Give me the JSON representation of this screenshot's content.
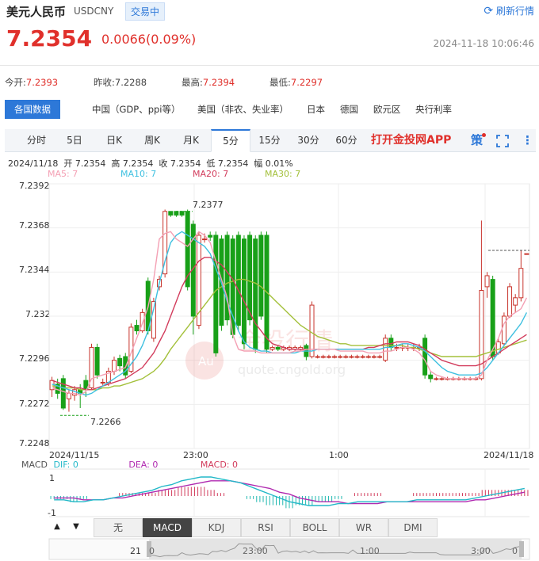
{
  "header": {
    "title": "美元人民币",
    "code": "USDCNY",
    "status": "交易中",
    "refresh": "刷新行情",
    "price": "7.2354",
    "change": "0.0066(0.09%)",
    "time": "2024-11-18 10:06:46"
  },
  "quote": {
    "open_label": "今开:",
    "open": "7.2393",
    "prev_label": "昨收:",
    "prev": "7.2288",
    "high_label": "最高:",
    "high": "7.2394",
    "low_label": "最低:",
    "low": "7.2297"
  },
  "data_tabs": [
    {
      "label": "各国数据"
    },
    {
      "label": "中国（GDP、ppi等）"
    },
    {
      "label": "美国（非农、失业率）"
    },
    {
      "label": "日本"
    },
    {
      "label": "德国"
    },
    {
      "label": "欧元区"
    },
    {
      "label": "央行利率"
    }
  ],
  "period_tabs": [
    "分时",
    "5日",
    "日K",
    "周K",
    "月K",
    "5分",
    "15分",
    "30分",
    "60分"
  ],
  "promo": "打开金投网APP",
  "icons": {
    "strategy": "策",
    "fullscreen": "fullscreen-icon",
    "more": "more-icon"
  },
  "info_line": "2024/11/18  开 7.2354  高 7.2354  收 7.2354  低 7.2354  幅 0.01%",
  "ma": {
    "ma5": "MA5: 7",
    "ma10": "MA10: 7",
    "ma20": "MA20: 7",
    "ma30": "MA30: 7",
    "colors": {
      "ma5": "#f4a0b4",
      "ma10": "#3ec0e0",
      "ma20": "#d23c5c",
      "ma30": "#a3c03a"
    }
  },
  "watermark": {
    "text": "金投行情",
    "url": "quote.cngold.org",
    "logo": "Au"
  },
  "chart_data": {
    "type": "candlestick",
    "y_ticks": [
      "7.2392",
      "7.2368",
      "7.2344",
      "7.232",
      "7.2296",
      "7.2272",
      "7.2248"
    ],
    "ylim": [
      7.2248,
      7.2392
    ],
    "x_labels": [
      "2024/11/15",
      "23:00",
      "1:00",
      "2024/11/18"
    ],
    "annotations": {
      "high": "7.2377",
      "low": "7.2266"
    },
    "candles": [
      {
        "o": 7.228,
        "c": 7.2285,
        "h": 7.2287,
        "l": 7.2276
      },
      {
        "o": 7.2283,
        "c": 7.2278,
        "h": 7.2286,
        "l": 7.2275
      },
      {
        "o": 7.2286,
        "c": 7.227,
        "h": 7.2288,
        "l": 7.2269
      },
      {
        "o": 7.2275,
        "c": 7.2278,
        "h": 7.228,
        "l": 7.2268
      },
      {
        "o": 7.2277,
        "c": 7.228,
        "h": 7.2282,
        "l": 7.2274
      },
      {
        "o": 7.228,
        "c": 7.2278,
        "h": 7.2283,
        "l": 7.227
      },
      {
        "o": 7.2285,
        "c": 7.228,
        "h": 7.2288,
        "l": 7.2276
      },
      {
        "o": 7.2281,
        "c": 7.2303,
        "h": 7.2305,
        "l": 7.228
      },
      {
        "o": 7.2303,
        "c": 7.2288,
        "h": 7.2305,
        "l": 7.2286
      },
      {
        "o": 7.2284,
        "c": 7.2284,
        "h": 7.2286,
        "l": 7.2282
      },
      {
        "o": 7.2284,
        "c": 7.229,
        "h": 7.2292,
        "l": 7.2282
      },
      {
        "o": 7.229,
        "c": 7.2296,
        "h": 7.2298,
        "l": 7.2288
      },
      {
        "o": 7.2297,
        "c": 7.2293,
        "h": 7.2299,
        "l": 7.229
      },
      {
        "o": 7.2298,
        "c": 7.2288,
        "h": 7.23,
        "l": 7.2286
      },
      {
        "o": 7.229,
        "c": 7.2314,
        "h": 7.2316,
        "l": 7.2289
      },
      {
        "o": 7.2315,
        "c": 7.2312,
        "h": 7.2318,
        "l": 7.231
      },
      {
        "o": 7.2312,
        "c": 7.2322,
        "h": 7.2324,
        "l": 7.2311
      },
      {
        "o": 7.2339,
        "c": 7.2312,
        "h": 7.2341,
        "l": 7.231
      },
      {
        "o": 7.2308,
        "c": 7.2328,
        "h": 7.233,
        "l": 7.2306
      },
      {
        "o": 7.2336,
        "c": 7.234,
        "h": 7.2342,
        "l": 7.2334
      },
      {
        "o": 7.2343,
        "c": 7.2377,
        "h": 7.2378,
        "l": 7.2341
      },
      {
        "o": 7.2377,
        "c": 7.2375,
        "h": 7.2377,
        "l": 7.2374
      },
      {
        "o": 7.2377,
        "c": 7.2375,
        "h": 7.2377,
        "l": 7.2374
      },
      {
        "o": 7.2377,
        "c": 7.2375,
        "h": 7.2377,
        "l": 7.2374
      },
      {
        "o": 7.2377,
        "c": 7.2336,
        "h": 7.2378,
        "l": 7.2334
      },
      {
        "o": 7.237,
        "c": 7.232,
        "h": 7.2372,
        "l": 7.231
      },
      {
        "o": 7.2315,
        "c": 7.2364,
        "h": 7.2366,
        "l": 7.2313
      },
      {
        "o": 7.2362,
        "c": 7.2362,
        "h": 7.2365,
        "l": 7.236
      },
      {
        "o": 7.2364,
        "c": 7.2363,
        "h": 7.2366,
        "l": 7.2361
      },
      {
        "o": 7.2364,
        "c": 7.23,
        "h": 7.2366,
        "l": 7.2298
      },
      {
        "o": 7.2362,
        "c": 7.2315,
        "h": 7.2364,
        "l": 7.2312
      },
      {
        "o": 7.2364,
        "c": 7.2318,
        "h": 7.2366,
        "l": 7.2315
      },
      {
        "o": 7.2362,
        "c": 7.231,
        "h": 7.2364,
        "l": 7.2308
      },
      {
        "o": 7.2364,
        "c": 7.2315,
        "h": 7.2366,
        "l": 7.2312
      },
      {
        "o": 7.2362,
        "c": 7.2305,
        "h": 7.2364,
        "l": 7.2302
      },
      {
        "o": 7.2364,
        "c": 7.2318,
        "h": 7.2366,
        "l": 7.2315
      },
      {
        "o": 7.2362,
        "c": 7.2302,
        "h": 7.2364,
        "l": 7.23
      },
      {
        "o": 7.2364,
        "c": 7.232,
        "h": 7.2366,
        "l": 7.2318
      },
      {
        "o": 7.2364,
        "c": 7.2302,
        "h": 7.2366,
        "l": 7.23
      },
      {
        "o": 7.2302,
        "c": 7.2303,
        "h": 7.2304,
        "l": 7.2301
      },
      {
        "o": 7.2303,
        "c": 7.2302,
        "h": 7.2304,
        "l": 7.2301
      },
      {
        "o": 7.2302,
        "c": 7.2303,
        "h": 7.2304,
        "l": 7.2301
      },
      {
        "o": 7.2302,
        "c": 7.2303,
        "h": 7.2304,
        "l": 7.2301
      },
      {
        "o": 7.2302,
        "c": 7.2303,
        "h": 7.2304,
        "l": 7.2301
      },
      {
        "o": 7.2302,
        "c": 7.2303,
        "h": 7.2304,
        "l": 7.2301
      },
      {
        "o": 7.2304,
        "c": 7.2298,
        "h": 7.2305,
        "l": 7.2296
      },
      {
        "o": 7.2298,
        "c": 7.2326,
        "h": 7.2328,
        "l": 7.2297
      },
      {
        "o": 7.2298,
        "c": 7.2298,
        "h": 7.2299,
        "l": 7.2297
      },
      {
        "o": 7.2298,
        "c": 7.2298,
        "h": 7.2299,
        "l": 7.2297
      },
      {
        "o": 7.2298,
        "c": 7.2298,
        "h": 7.2299,
        "l": 7.2297
      },
      {
        "o": 7.2298,
        "c": 7.2298,
        "h": 7.2299,
        "l": 7.2297
      },
      {
        "o": 7.2298,
        "c": 7.2298,
        "h": 7.2299,
        "l": 7.2297
      },
      {
        "o": 7.2298,
        "c": 7.2298,
        "h": 7.2299,
        "l": 7.2297
      },
      {
        "o": 7.2298,
        "c": 7.2298,
        "h": 7.2299,
        "l": 7.2297
      },
      {
        "o": 7.2298,
        "c": 7.2298,
        "h": 7.2299,
        "l": 7.2297
      },
      {
        "o": 7.2298,
        "c": 7.2298,
        "h": 7.2299,
        "l": 7.2297
      },
      {
        "o": 7.2298,
        "c": 7.2298,
        "h": 7.2299,
        "l": 7.2297
      },
      {
        "o": 7.2298,
        "c": 7.2298,
        "h": 7.2299,
        "l": 7.2297
      },
      {
        "o": 7.2298,
        "c": 7.2298,
        "h": 7.2299,
        "l": 7.2297
      },
      {
        "o": 7.2296,
        "c": 7.2308,
        "h": 7.231,
        "l": 7.2295
      },
      {
        "o": 7.2308,
        "c": 7.2303,
        "h": 7.231,
        "l": 7.2301
      },
      {
        "o": 7.2303,
        "c": 7.2303,
        "h": 7.2305,
        "l": 7.2301
      },
      {
        "o": 7.2303,
        "c": 7.2303,
        "h": 7.2305,
        "l": 7.2301
      },
      {
        "o": 7.2303,
        "c": 7.2303,
        "h": 7.2305,
        "l": 7.2301
      },
      {
        "o": 7.2303,
        "c": 7.2303,
        "h": 7.2305,
        "l": 7.2301
      },
      {
        "o": 7.2303,
        "c": 7.2303,
        "h": 7.2305,
        "l": 7.2301
      },
      {
        "o": 7.2308,
        "c": 7.2288,
        "h": 7.231,
        "l": 7.2286
      },
      {
        "o": 7.2288,
        "c": 7.2286,
        "h": 7.229,
        "l": 7.2284
      },
      {
        "o": 7.2286,
        "c": 7.2286,
        "h": 7.2287,
        "l": 7.2285
      },
      {
        "o": 7.2286,
        "c": 7.2286,
        "h": 7.2287,
        "l": 7.2285
      },
      {
        "o": 7.2286,
        "c": 7.2286,
        "h": 7.2287,
        "l": 7.2285
      },
      {
        "o": 7.2286,
        "c": 7.2286,
        "h": 7.2287,
        "l": 7.2285
      },
      {
        "o": 7.2286,
        "c": 7.2286,
        "h": 7.2287,
        "l": 7.2285
      },
      {
        "o": 7.2286,
        "c": 7.2286,
        "h": 7.2287,
        "l": 7.2285
      },
      {
        "o": 7.2286,
        "c": 7.2286,
        "h": 7.2287,
        "l": 7.2285
      },
      {
        "o": 7.2286,
        "c": 7.2286,
        "h": 7.2287,
        "l": 7.2285
      },
      {
        "o": 7.2286,
        "c": 7.2334,
        "h": 7.2372,
        "l": 7.2285
      },
      {
        "o": 7.2336,
        "c": 7.2342,
        "h": 7.2344,
        "l": 7.233
      },
      {
        "o": 7.234,
        "c": 7.2298,
        "h": 7.2342,
        "l": 7.2296
      },
      {
        "o": 7.23,
        "c": 7.2306,
        "h": 7.2308,
        "l": 7.2299
      },
      {
        "o": 7.2305,
        "c": 7.232,
        "h": 7.2322,
        "l": 7.2304
      },
      {
        "o": 7.232,
        "c": 7.2336,
        "h": 7.2338,
        "l": 7.2319
      },
      {
        "o": 7.2326,
        "c": 7.233,
        "h": 7.2332,
        "l": 7.2322
      },
      {
        "o": 7.233,
        "c": 7.2346,
        "h": 7.2356,
        "l": 7.2328
      },
      {
        "o": 7.2354,
        "c": 7.2354,
        "h": 7.2354,
        "l": 7.2354
      }
    ],
    "ma5": [
      7.2281,
      7.228,
      7.2279,
      7.2278,
      7.2278,
      7.2277,
      7.2279,
      7.2286,
      7.2287,
      7.2288,
      7.2289,
      7.229,
      7.2291,
      7.2292,
      7.23,
      7.2308,
      7.2316,
      7.2325,
      7.234,
      7.2362,
      7.2365,
      7.2366,
      7.2362,
      7.236,
      7.2358,
      7.2362,
      7.2366,
      7.2364,
      7.236,
      7.235,
      7.234,
      7.233,
      7.231,
      7.2302,
      7.2301,
      7.2301,
      7.2301,
      7.23,
      7.23,
      7.23,
      7.23,
      7.23,
      7.23,
      7.2301,
      7.2301,
      7.2302,
      7.2302,
      7.2302,
      7.2302,
      7.2302,
      7.2302,
      7.2301,
      7.2301,
      7.2301,
      7.2301,
      7.2301,
      7.23,
      7.23,
      7.23,
      7.2301,
      7.2301,
      7.2302,
      7.2303,
      7.2303,
      7.2302,
      7.23,
      7.2296,
      7.229,
      7.2288,
      7.2287,
      7.2286,
      7.2286,
      7.2286,
      7.2286,
      7.2286,
      7.2286,
      7.2288,
      7.2296,
      7.2302,
      7.2308,
      7.2316,
      7.232,
      7.2322,
      7.2324,
      7.233
    ],
    "ma10": [
      7.2283,
      7.2282,
      7.2281,
      7.228,
      7.2279,
      7.2278,
      7.2277,
      7.2278,
      7.228,
      7.2282,
      7.2284,
      7.2286,
      7.2288,
      7.229,
      7.2294,
      7.2298,
      7.2304,
      7.2312,
      7.2324,
      7.2338,
      7.235,
      7.236,
      7.2364,
      7.2366,
      7.2364,
      7.2362,
      7.236,
      7.2358,
      7.2354,
      7.2346,
      7.2338,
      7.2328,
      7.232,
      7.2312,
      7.2306,
      7.2303,
      7.2302,
      7.2301,
      7.2301,
      7.23,
      7.23,
      7.23,
      7.23,
      7.23,
      7.2301,
      7.2301,
      7.2301,
      7.2302,
      7.2302,
      7.2302,
      7.2302,
      7.2302,
      7.2302,
      7.2302,
      7.2302,
      7.2302,
      7.2302,
      7.2302,
      7.2302,
      7.2303,
      7.2303,
      7.2304,
      7.2305,
      7.2305,
      7.2304,
      7.2303,
      7.2301,
      7.2298,
      7.2295,
      7.2292,
      7.229,
      7.2289,
      7.2288,
      7.2288,
      7.2288,
      7.2288,
      7.2289,
      7.2292,
      7.2296,
      7.23,
      7.2304,
      7.2308,
      7.2312,
      7.2316,
      7.2322
    ],
    "ma20": [
      7.2285,
      7.2284,
      7.2283,
      7.2282,
      7.2281,
      7.2281,
      7.228,
      7.228,
      7.2281,
      7.2282,
      7.2283,
      7.2284,
      7.2285,
      7.2286,
      7.2288,
      7.229,
      7.2292,
      7.2296,
      7.23,
      7.2306,
      7.2312,
      7.232,
      7.2328,
      7.2336,
      7.2342,
      7.2346,
      7.235,
      7.2352,
      7.2352,
      7.235,
      7.2348,
      7.2344,
      7.234,
      7.2334,
      7.2328,
      7.2322,
      7.2316,
      7.2312,
      7.2308,
      7.2305,
      7.2304,
      7.2303,
      7.2302,
      7.2302,
      7.2302,
      7.2302,
      7.2302,
      7.2302,
      7.2302,
      7.2302,
      7.2302,
      7.2302,
      7.2302,
      7.2302,
      7.2302,
      7.2302,
      7.2303,
      7.2303,
      7.2304,
      7.2305,
      7.2305,
      7.2306,
      7.2306,
      7.2306,
      7.2305,
      7.2304,
      7.2302,
      7.23,
      7.2298,
      7.2296,
      7.2295,
      7.2294,
      7.2293,
      7.2293,
      7.2293,
      7.2293,
      7.2294,
      7.2296,
      7.2298,
      7.23,
      7.2302,
      7.2304,
      7.2306,
      7.2308,
      7.231
    ],
    "ma30": [
      7.2282,
      7.2282,
      7.2281,
      7.2281,
      7.2281,
      7.228,
      7.228,
      7.228,
      7.228,
      7.2281,
      7.2281,
      7.2282,
      7.2282,
      7.2283,
      7.2284,
      7.2285,
      7.2286,
      7.2288,
      7.229,
      7.2293,
      7.2297,
      7.2302,
      7.2306,
      7.231,
      7.2314,
      7.2318,
      7.2322,
      7.2326,
      7.233,
      7.2334,
      7.2336,
      7.2338,
      7.2339,
      7.234,
      7.234,
      7.2339,
      7.2338,
      7.2336,
      7.2333,
      7.233,
      7.2327,
      7.2324,
      7.2321,
      7.2318,
      7.2315,
      7.2313,
      7.2311,
      7.2309,
      7.2308,
      7.2307,
      7.2306,
      7.2305,
      7.2305,
      7.2304,
      7.2304,
      7.2304,
      7.2304,
      7.2304,
      7.2304,
      7.2304,
      7.2304,
      7.2304,
      7.2304,
      7.2303,
      7.2303,
      7.2302,
      7.2301,
      7.23,
      7.2299,
      7.2298,
      7.2298,
      7.2298,
      7.2298,
      7.2298,
      7.2298,
      7.2298,
      7.2299,
      7.23,
      7.2301,
      7.2302,
      7.2303,
      7.2304,
      7.2305,
      7.2306,
      7.2307
    ]
  },
  "macd": {
    "label": "MACD",
    "dif_label": "DIF: 0",
    "dea_label": "DEA: 0",
    "macd_label": "MACD: 0",
    "y_top": "1",
    "y_bottom": "-1",
    "dif_color": "#22b8c8",
    "dea_color": "#b02ab0",
    "dif": [
      -0.2,
      -0.2,
      -0.3,
      -0.3,
      -0.2,
      -0.2,
      -0.1,
      0.0,
      0.1,
      0.2,
      0.3,
      0.5,
      0.6,
      0.8,
      0.9,
      1.0,
      1.0,
      0.9,
      0.8,
      0.7,
      0.5,
      0.3,
      0.1,
      -0.1,
      -0.3,
      -0.4,
      -0.5,
      -0.5,
      -0.5,
      -0.4,
      -0.4,
      -0.3,
      -0.3,
      -0.3,
      -0.3,
      -0.3,
      -0.3,
      -0.2,
      -0.2,
      -0.2,
      -0.2,
      -0.2,
      -0.2,
      -0.1,
      0.0,
      0.1,
      0.2,
      0.3,
      0.4
    ],
    "dea": [
      -0.1,
      -0.1,
      -0.1,
      -0.2,
      -0.2,
      -0.2,
      -0.1,
      -0.1,
      0.0,
      0.1,
      0.2,
      0.3,
      0.4,
      0.5,
      0.6,
      0.7,
      0.8,
      0.8,
      0.8,
      0.7,
      0.6,
      0.5,
      0.4,
      0.2,
      0.1,
      -0.1,
      -0.2,
      -0.3,
      -0.3,
      -0.3,
      -0.4,
      -0.4,
      -0.4,
      -0.4,
      -0.3,
      -0.3,
      -0.3,
      -0.3,
      -0.3,
      -0.3,
      -0.3,
      -0.3,
      -0.3,
      -0.2,
      -0.2,
      -0.1,
      0.0,
      0.1,
      0.2
    ]
  },
  "indicator_tabs": [
    "无",
    "MACD",
    "KDJ",
    "RSI",
    "BOLL",
    "WR",
    "DMI"
  ],
  "active_indicator": "MACD",
  "navigator": {
    "left_num": "21",
    "ticks": [
      "0",
      "23:00",
      "1:00",
      "3:00",
      "0"
    ]
  }
}
